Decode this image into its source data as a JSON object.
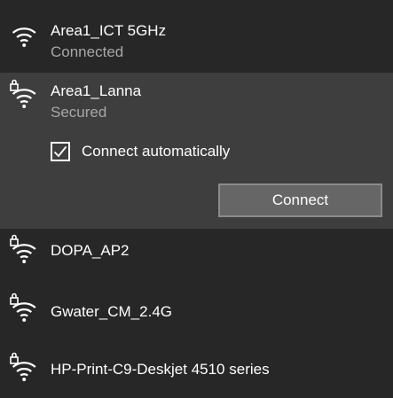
{
  "colors": {
    "background": "#272727",
    "selected_background": "#3e3e3e",
    "secondary_text": "#a7a7a7",
    "button_background": "#666666",
    "button_border": "#8b8b8b"
  },
  "networks": [
    {
      "name": "Area1_ICT 5GHz",
      "status": "Connected",
      "secured": false,
      "icon": "wifi-signal-icon"
    },
    {
      "name": "Area1_Lanna",
      "status": "Secured",
      "secured": true,
      "icon": "wifi-secured-icon",
      "selected": true,
      "auto_connect_label": "Connect automatically",
      "auto_connect_checked": true,
      "connect_label": "Connect"
    },
    {
      "name": "DOPA_AP2",
      "secured": true,
      "icon": "wifi-secured-icon"
    },
    {
      "name": "Gwater_CM_2.4G",
      "secured": true,
      "icon": "wifi-secured-icon"
    },
    {
      "name": "HP-Print-C9-Deskjet 4510 series",
      "secured": true,
      "icon": "wifi-secured-icon"
    }
  ]
}
